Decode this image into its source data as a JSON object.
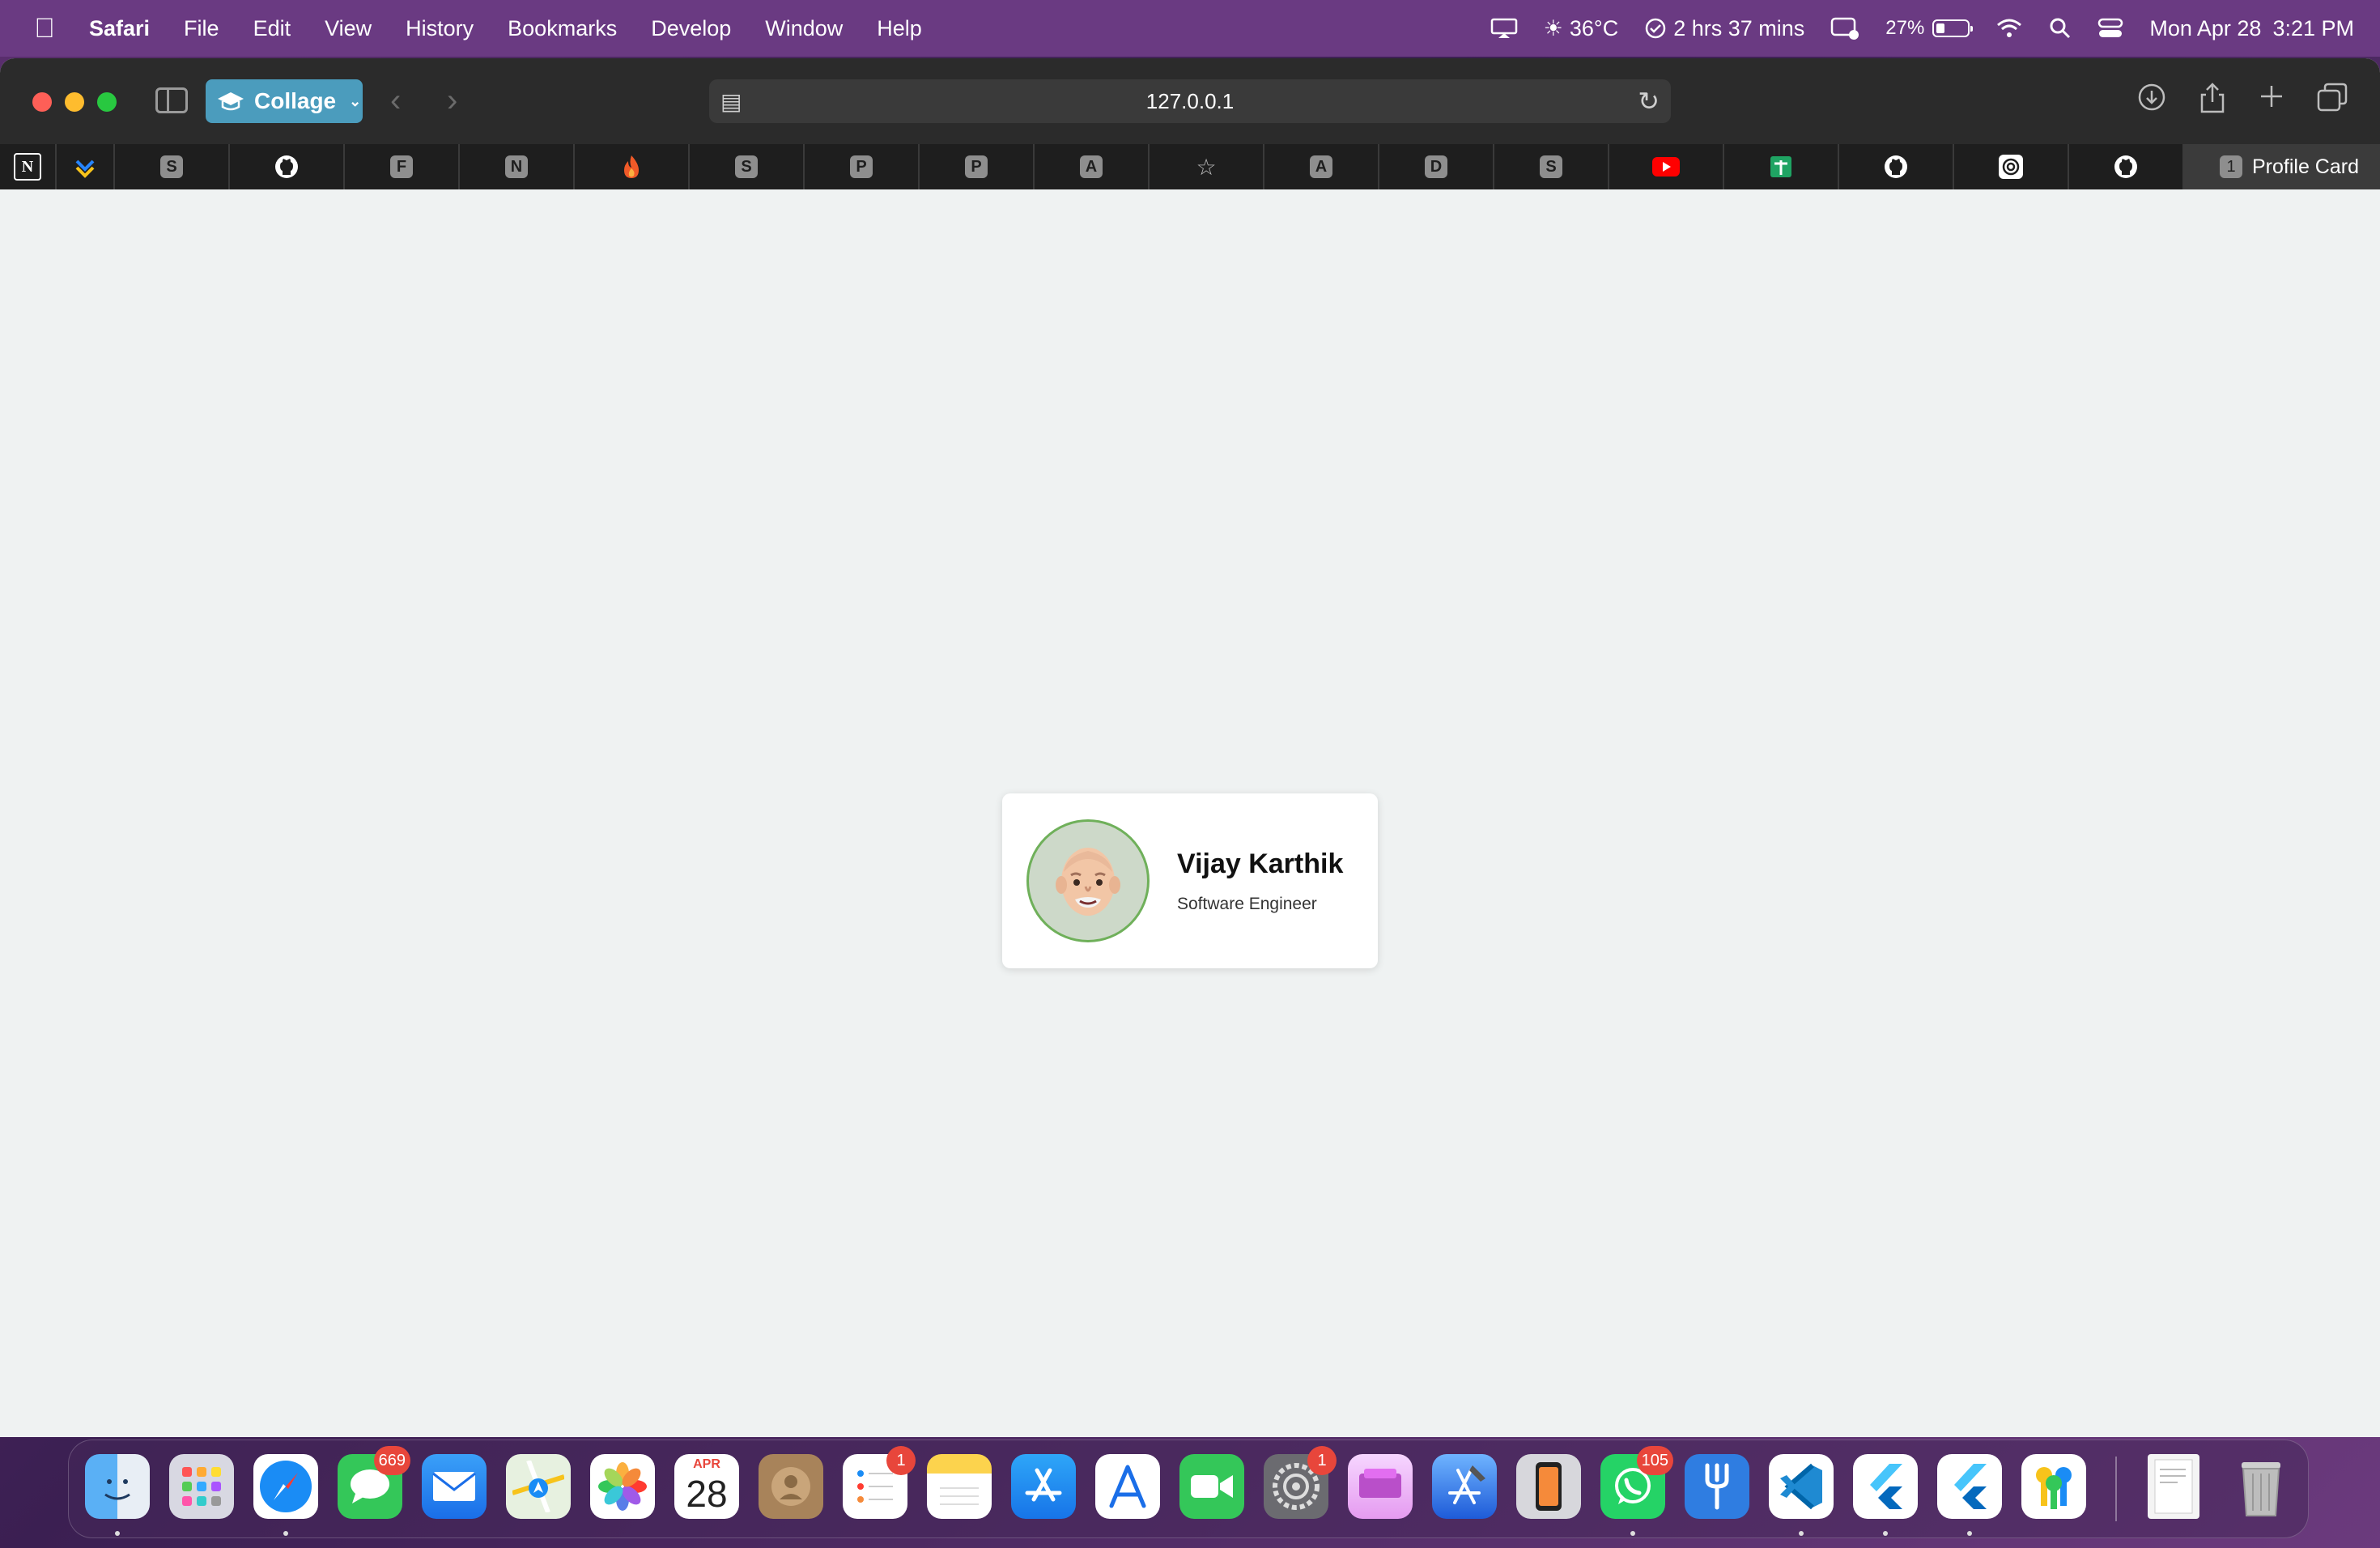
{
  "menubar": {
    "app_name": "Safari",
    "items": [
      "File",
      "Edit",
      "View",
      "History",
      "Bookmarks",
      "Develop",
      "Window",
      "Help"
    ],
    "weather": "36°C",
    "screen_time": "2 hrs 37 mins",
    "battery_percent": "27%",
    "battery_level": 0.27,
    "date": "Mon Apr 28",
    "time": "3:21 PM"
  },
  "toolbar": {
    "profile_label": "Collage",
    "url": "127.0.0.1"
  },
  "tabs": {
    "pinned": [
      "notion-icon",
      "jira-icon",
      "S",
      "github-icon",
      "F",
      "N",
      "flame-icon",
      "S",
      "P",
      "P",
      "A",
      "star-icon",
      "A",
      "D",
      "S",
      "youtube-icon",
      "sheets-icon",
      "github-icon",
      "openai-icon",
      "github-icon"
    ],
    "active_badge": "1",
    "active_title": "Profile Card"
  },
  "card": {
    "name": "Vijay Karthik",
    "role": "Software Engineer"
  },
  "dock": {
    "calendar_month": "APR",
    "calendar_day": "28",
    "badges": {
      "messages": "669",
      "reminders": "1",
      "settings": "1",
      "whatsapp": "105"
    }
  },
  "colors": {
    "menubar": "#6a3a82",
    "toolbar": "#2b2b2b",
    "profile_button": "#4b9cbd",
    "page_background": "#eff2f2",
    "avatar_border": "#6fb05a"
  }
}
